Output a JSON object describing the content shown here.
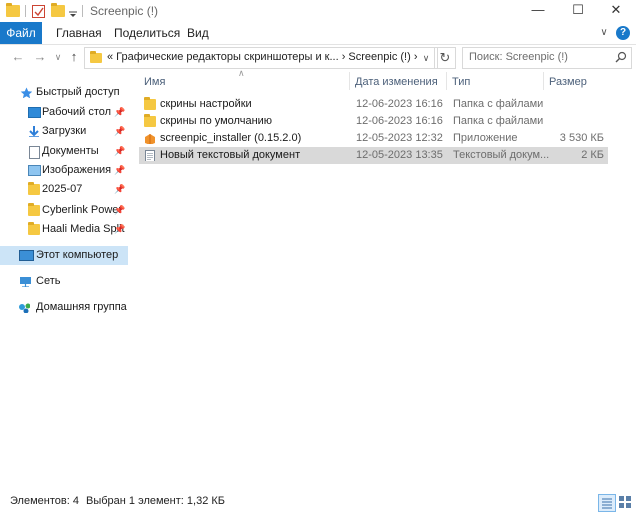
{
  "window": {
    "title": "Screenpic (!)",
    "minimize": "—",
    "maximize": "☐",
    "close": "✕"
  },
  "ribbon": {
    "tabs": [
      "Файл",
      "Главная",
      "Поделиться",
      "Вид"
    ],
    "expand": "∨",
    "help": "?"
  },
  "nav": {
    "back": "←",
    "forward": "→",
    "recent": "∨",
    "up": "↑"
  },
  "address": {
    "path": "«  Графические редакторы скриншотеры и к...  ›  Screenpic (!)  ›",
    "dropdown": "∨",
    "refresh": "↻"
  },
  "search": {
    "placeholder": "Поиск: Screenpic (!)"
  },
  "navpane": {
    "items": [
      {
        "label": "Быстрый доступ",
        "icon": "star-icon"
      },
      {
        "label": "Рабочий стол",
        "icon": "desktop-icon",
        "pinned": true
      },
      {
        "label": "Загрузки",
        "icon": "download-icon",
        "pinned": true
      },
      {
        "label": "Документы",
        "icon": "documents-icon",
        "pinned": true
      },
      {
        "label": "Изображения",
        "icon": "pictures-icon",
        "pinned": true
      },
      {
        "label": "2025-07",
        "icon": "folder-icon",
        "pinned": true
      },
      {
        "label": "Cyberlink Power",
        "icon": "folder-icon",
        "pinned": true
      },
      {
        "label": "Haali Media Split",
        "icon": "folder-icon",
        "pinned": true
      },
      {
        "label": "Этот компьютер",
        "icon": "computer-icon",
        "selected": true
      },
      {
        "label": "Сеть",
        "icon": "network-icon"
      },
      {
        "label": "Домашняя группа",
        "icon": "homegroup-icon"
      }
    ],
    "pin_glyph": "📌"
  },
  "columns": {
    "name": "Имя",
    "date": "Дата изменения",
    "type": "Тип",
    "size": "Размер",
    "sort_glyph": "∧"
  },
  "files": [
    {
      "name": "скрины настройки",
      "date": "12-06-2023 16:16",
      "type": "Папка с файлами",
      "size": "",
      "icon": "folder-icon"
    },
    {
      "name": "скрины по умолчанию",
      "date": "12-06-2023 16:16",
      "type": "Папка с файлами",
      "size": "",
      "icon": "folder-icon"
    },
    {
      "name": "screenpic_installer (0.15.2.0)",
      "date": "12-05-2023 12:32",
      "type": "Приложение",
      "size": "3 530 КБ",
      "icon": "installer-icon"
    },
    {
      "name": "Новый текстовый документ",
      "date": "12-05-2023 13:35",
      "type": "Текстовый докум...",
      "size": "2 КБ",
      "icon": "text-file-icon",
      "selected": true
    }
  ],
  "status": {
    "count": "Элементов: 4",
    "selection": "Выбран 1 элемент: 1,32 КБ"
  },
  "colors": {
    "accent": "#1979ca",
    "nav_selected": "#cce4f7",
    "row_selected": "#d9d9d9",
    "folder": "#f5c842"
  }
}
